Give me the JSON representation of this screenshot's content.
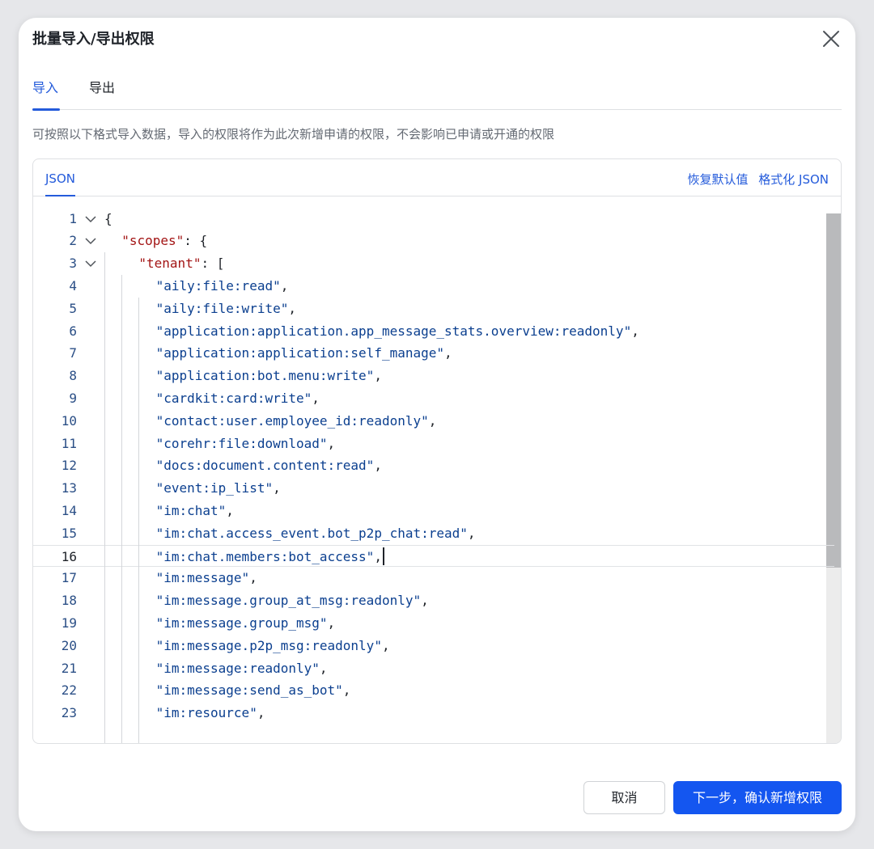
{
  "modal": {
    "title": "批量导入/导出权限",
    "tabs": [
      {
        "label": "导入",
        "active": true
      },
      {
        "label": "导出",
        "active": false
      }
    ],
    "description": "可按照以下格式导入数据，导入的权限将作为此次新增申请的权限，不会影响已申请或开通的权限"
  },
  "editor": {
    "tab_label": "JSON",
    "actions": {
      "reset_label": "恢复默认值",
      "format_label": "格式化 JSON"
    },
    "current_line": 16,
    "lines": [
      {
        "no": "1",
        "fold": true,
        "indent": 0,
        "parts": [
          [
            "punc",
            "{"
          ]
        ]
      },
      {
        "no": "2",
        "fold": true,
        "indent": 1,
        "parts": [
          [
            "key",
            "\"scopes\""
          ],
          [
            "punc",
            ": {"
          ]
        ]
      },
      {
        "no": "3",
        "fold": true,
        "indent": 2,
        "parts": [
          [
            "key",
            "\"tenant\""
          ],
          [
            "punc",
            ": ["
          ]
        ]
      },
      {
        "no": "4",
        "fold": false,
        "indent": 3,
        "parts": [
          [
            "str",
            "\"aily:file:read\""
          ],
          [
            "punc",
            ","
          ]
        ]
      },
      {
        "no": "5",
        "fold": false,
        "indent": 3,
        "parts": [
          [
            "str",
            "\"aily:file:write\""
          ],
          [
            "punc",
            ","
          ]
        ]
      },
      {
        "no": "6",
        "fold": false,
        "indent": 3,
        "parts": [
          [
            "str",
            "\"application:application.app_message_stats.overview:readonly\""
          ],
          [
            "punc",
            ","
          ]
        ]
      },
      {
        "no": "7",
        "fold": false,
        "indent": 3,
        "parts": [
          [
            "str",
            "\"application:application:self_manage\""
          ],
          [
            "punc",
            ","
          ]
        ]
      },
      {
        "no": "8",
        "fold": false,
        "indent": 3,
        "parts": [
          [
            "str",
            "\"application:bot.menu:write\""
          ],
          [
            "punc",
            ","
          ]
        ]
      },
      {
        "no": "9",
        "fold": false,
        "indent": 3,
        "parts": [
          [
            "str",
            "\"cardkit:card:write\""
          ],
          [
            "punc",
            ","
          ]
        ]
      },
      {
        "no": "10",
        "fold": false,
        "indent": 3,
        "parts": [
          [
            "str",
            "\"contact:user.employee_id:readonly\""
          ],
          [
            "punc",
            ","
          ]
        ]
      },
      {
        "no": "11",
        "fold": false,
        "indent": 3,
        "parts": [
          [
            "str",
            "\"corehr:file:download\""
          ],
          [
            "punc",
            ","
          ]
        ]
      },
      {
        "no": "12",
        "fold": false,
        "indent": 3,
        "parts": [
          [
            "str",
            "\"docs:document.content:read\""
          ],
          [
            "punc",
            ","
          ]
        ]
      },
      {
        "no": "13",
        "fold": false,
        "indent": 3,
        "parts": [
          [
            "str",
            "\"event:ip_list\""
          ],
          [
            "punc",
            ","
          ]
        ]
      },
      {
        "no": "14",
        "fold": false,
        "indent": 3,
        "parts": [
          [
            "str",
            "\"im:chat\""
          ],
          [
            "punc",
            ","
          ]
        ]
      },
      {
        "no": "15",
        "fold": false,
        "indent": 3,
        "parts": [
          [
            "str",
            "\"im:chat.access_event.bot_p2p_chat:read\""
          ],
          [
            "punc",
            ","
          ]
        ]
      },
      {
        "no": "16",
        "fold": false,
        "indent": 3,
        "parts": [
          [
            "str",
            "\"im:chat.members:bot_access\""
          ],
          [
            "punc",
            ","
          ]
        ]
      },
      {
        "no": "17",
        "fold": false,
        "indent": 3,
        "parts": [
          [
            "str",
            "\"im:message\""
          ],
          [
            "punc",
            ","
          ]
        ]
      },
      {
        "no": "18",
        "fold": false,
        "indent": 3,
        "parts": [
          [
            "str",
            "\"im:message.group_at_msg:readonly\""
          ],
          [
            "punc",
            ","
          ]
        ]
      },
      {
        "no": "19",
        "fold": false,
        "indent": 3,
        "parts": [
          [
            "str",
            "\"im:message.group_msg\""
          ],
          [
            "punc",
            ","
          ]
        ]
      },
      {
        "no": "20",
        "fold": false,
        "indent": 3,
        "parts": [
          [
            "str",
            "\"im:message.p2p_msg:readonly\""
          ],
          [
            "punc",
            ","
          ]
        ]
      },
      {
        "no": "21",
        "fold": false,
        "indent": 3,
        "parts": [
          [
            "str",
            "\"im:message:readonly\""
          ],
          [
            "punc",
            ","
          ]
        ]
      },
      {
        "no": "22",
        "fold": false,
        "indent": 3,
        "parts": [
          [
            "str",
            "\"im:message:send_as_bot\""
          ],
          [
            "punc",
            ","
          ]
        ]
      },
      {
        "no": "23",
        "fold": false,
        "indent": 3,
        "parts": [
          [
            "str",
            "\"im:resource\""
          ],
          [
            "punc",
            ","
          ]
        ]
      }
    ]
  },
  "footer": {
    "cancel_label": "取消",
    "next_label": "下一步，确认新增权限"
  },
  "icons": {
    "close": "close-icon",
    "fold": "chevron-down-icon"
  },
  "colors": {
    "accent": "#245bdb",
    "primary_button": "#1456f0",
    "json_key": "#a31515",
    "json_string": "#0b3f8f"
  }
}
